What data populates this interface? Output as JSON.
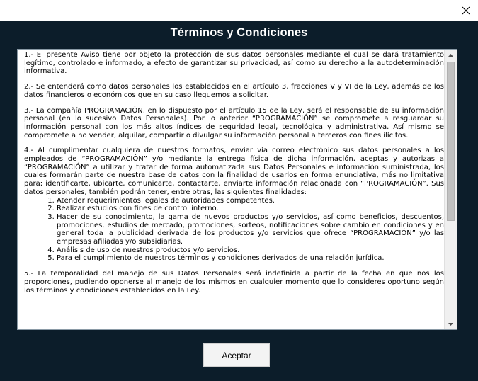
{
  "window": {
    "close_icon": "close-icon"
  },
  "dialog": {
    "title": "Términos y Condiciones",
    "accept_label": "Aceptar"
  },
  "terms": {
    "p1": "1.- El presente Aviso tiene por objeto la protección de sus datos personales mediante el cual se dará tratamiento legítimo, controlado e informado, a efecto de garantizar su privacidad, así como su derecho a la autodeterminación informativa.",
    "p2": "2.- Se entenderá como datos personales los establecidos en el artículo 3, fracciones V y VI de la Ley, además de los datos financieros o económicos que en su caso lleguemos a solicitar.",
    "p3": "3.- La compañía PROGRAMACIÓN, en lo dispuesto por el artículo 15 de la Ley, será el responsable de su información personal (en lo sucesivo Datos Personales). Por lo anterior “PROGRAMACIÓN” se compromete a resguardar su información personal con los más altos índices de seguridad legal, tecnológica y administrativa. Así mismo se compromete a no vender, alquilar, compartir o divulgar su información personal a terceros con fines ilícitos.",
    "p4": "4.- Al cumplimentar cualquiera de nuestros formatos, enviar vía correo electrónico sus datos personales a los empleados de “PROGRAMACIÓN” y/o mediante la entrega física de dicha información, aceptas y autorizas a “PROGRAMACIÓN” a utilizar y tratar de forma automatizada sus Datos Personales e información suministrada, los cuales formarán parte de nuestra base de datos con la finalidad de usarlos en forma enunciativa, más no limitativa para: identificarte, ubicarte, comunicarte, contactarte, enviarte información relacionada con “PROGRAMACIÓN”. Sus datos personales, también podrán tener, entre otras, las siguientes finalidades:",
    "list": [
      "Atender requerimientos legales de autoridades competentes.",
      "Realizar estudios con fines de control interno.",
      "Hacer de su conocimiento, la gama de nuevos productos y/o servicios, así como beneficios, descuentos, promociones, estudios de mercado, promociones, sorteos, notificaciones sobre cambio en condiciones y en general toda la publicidad derivada de los productos y/o servicios que ofrece “PROGRAMACIÓN” y/o las empresas afiliadas y/o subsidiarias.",
      "Análisis de uso de nuestros productos y/o servicios.",
      "Para el cumplimiento de nuestros términos y condiciones derivados de una relación jurídica."
    ],
    "p5": "5.- La temporalidad del manejo de sus Datos Personales será indefinida a partir de la fecha en que nos los proporciones, pudiendo oponerse al manejo de los mismos en cualquier momento que lo consideres oportuno según los términos y condiciones establecidos en la Ley."
  },
  "scrollbar": {
    "position_fraction": 0.0
  }
}
